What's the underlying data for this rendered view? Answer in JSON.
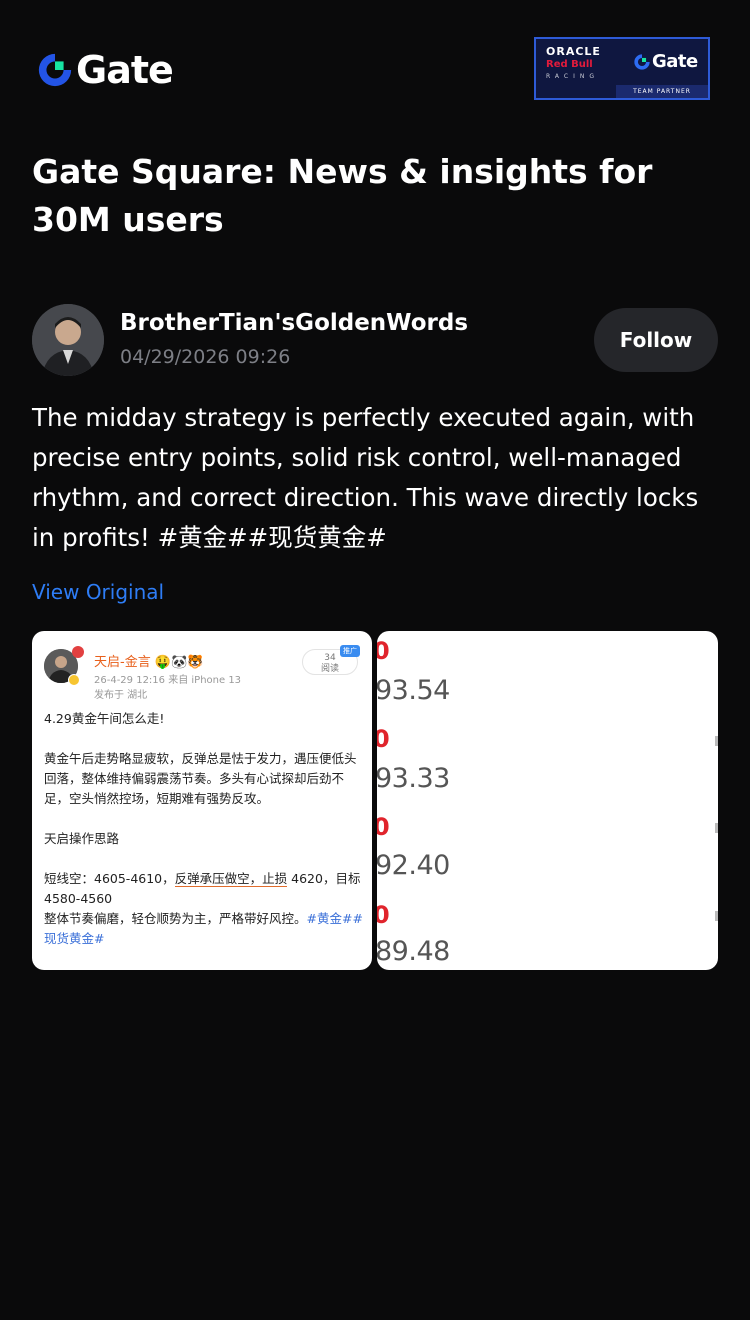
{
  "header": {
    "logo_text": "Gate",
    "partner": {
      "oracle": "ORACLE",
      "redbull": "Red Bull",
      "racing": "RACING",
      "gate": "Gate",
      "team_partner": "TEAM PARTNER"
    }
  },
  "page_title": "Gate Square: News & insights for 30M users",
  "post": {
    "author": "BrotherTian'sGoldenWords",
    "time": "04/29/2026 09:26",
    "follow_label": "Follow",
    "body": "The midday strategy is perfectly executed again, with precise entry points, solid risk control, well-managed rhythm, and correct direction. This wave directly locks in profits! #黄金##现货黄金#",
    "view_original": "View Original"
  },
  "images": {
    "left": {
      "name": "天启-金言 🤑🐼🐯",
      "meta": "26-4-29 12:16  来自 iPhone 13",
      "location": "发布于 湖北",
      "reads_count": "34",
      "reads_label": "阅读",
      "tag": "推广",
      "line1": "4.29黄金午间怎么走!",
      "line2": "黄金午后走势略显疲软，反弹总是怯于发力，遇压便低头回落，整体维持偏弱震荡节奏。多头有心试探却后劲不足，空头悄然控场，短期难有强势反攻。",
      "line3": "天启操作思路",
      "line4_prefix": "短线空：4605-4610，",
      "line4_hl": "反弹承压做空，止损",
      "line4_rest": " 4620，目标4580-4560",
      "line5": "整体节奏偏磨，轻仓顺势为主，严格带好风控。",
      "line5_hash": "#黄金##现货黄金#"
    },
    "right": {
      "prices": [
        "93.54",
        "93.33",
        "92.40",
        "89.48"
      ],
      "red_marks": [
        "0",
        "0",
        "0",
        "0"
      ]
    }
  }
}
